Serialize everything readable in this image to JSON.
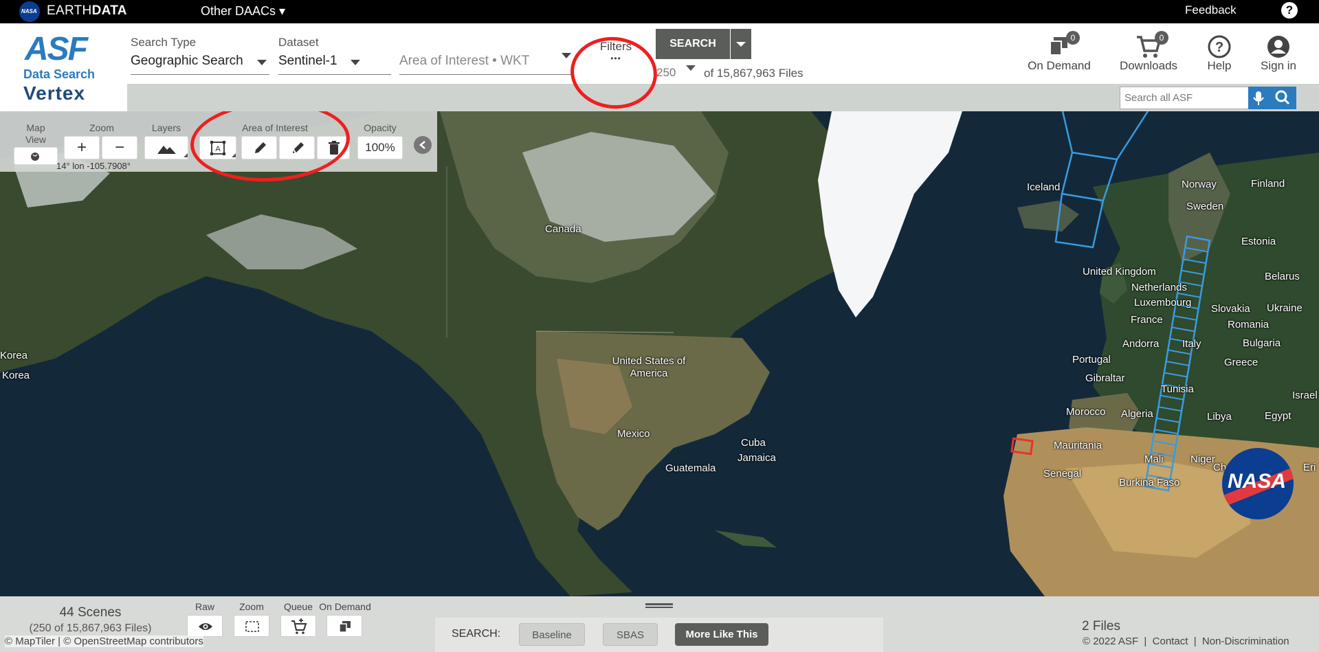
{
  "topbar": {
    "nasa_logo_text": "NASA",
    "brand_light": "EARTH",
    "brand_bold": "DATA",
    "other_daacs": "Other DAACs ▾",
    "feedback": "Feedback",
    "help": "?"
  },
  "header": {
    "logo": {
      "asf": "ASF",
      "data_search": "Data Search",
      "vertex": "Vertex"
    },
    "search_type": {
      "label": "Search Type",
      "value": "Geographic Search"
    },
    "dataset": {
      "label": "Dataset",
      "value": "Sentinel-1"
    },
    "aoi": {
      "placeholder": "Area of Interest • WKT"
    },
    "filters": {
      "label": "Filters",
      "dots": "•••"
    },
    "max_results": "250",
    "file_count": "of 15,867,963 Files",
    "search_button": "SEARCH",
    "on_demand": {
      "label": "On Demand",
      "count": "0"
    },
    "downloads": {
      "label": "Downloads",
      "count": "0"
    },
    "help": "Help",
    "sign_in": "Sign in",
    "asf_search_placeholder": "Search all ASF"
  },
  "map_toolbar": {
    "map_view_label": "Map View",
    "zoom_label": "Zoom",
    "zoom_in": "+",
    "zoom_out": "−",
    "layers_label": "Layers",
    "aoi_label": "Area of Interest",
    "opacity_label": "Opacity",
    "opacity_value": "100%",
    "coords": "14°   lon -105.7908°"
  },
  "map_places": {
    "canada": "Canada",
    "usa": "United States of America",
    "mexico": "Mexico",
    "cuba": "Cuba",
    "jamaica": "Jamaica",
    "guatemala": "Guatemala",
    "iceland": "Iceland",
    "norway": "Norway",
    "finland": "Finland",
    "sweden": "Sweden",
    "estonia": "Estonia",
    "uk": "United Kingdom",
    "belarus": "Belarus",
    "netherlands": "Netherlands",
    "luxembourg": "Luxembourg",
    "slovakia": "Slovakia",
    "ukraine": "Ukraine",
    "france": "France",
    "romania": "Romania",
    "andorra": "Andorra",
    "italy": "Italy",
    "bulgaria": "Bulgaria",
    "portugal": "Portugal",
    "greece": "Greece",
    "gibraltar": "Gibraltar",
    "tunisia": "Tunisia",
    "israel": "Israel",
    "morocco": "Morocco",
    "algeria": "Algeria",
    "libya": "Libya",
    "egypt": "Egypt",
    "mauritania": "Mauritania",
    "mali": "Mali",
    "niger": "Niger",
    "senegal": "Senegal",
    "burkina_faso": "Burkina Faso",
    "korea_1": "Korea",
    "korea_2": "Korea",
    "ch": "Ch",
    "er": "Eri",
    "nasa_meatball": "NASA"
  },
  "bottom": {
    "scenes_count": "44 Scenes",
    "scenes_sub": "(250 of 15,867,963 Files)",
    "raw": "Raw",
    "zoom": "Zoom",
    "queue": "Queue",
    "on_demand": "On Demand",
    "search_label": "SEARCH:",
    "baseline": "Baseline",
    "sbas": "SBAS",
    "more_like_this": "More Like This",
    "files_count": "2 Files",
    "attribution": "© MapTiler | © OpenStreetMap contributors",
    "footer_links": "© 2022 ASF  |  Contact  |  Non-Discrimination"
  },
  "colors": {
    "footprint_blue": "#3a9be0",
    "annotation_red": "#ee1f1f",
    "selected_red": "#e8322e",
    "accent": "#2b7bbf"
  }
}
